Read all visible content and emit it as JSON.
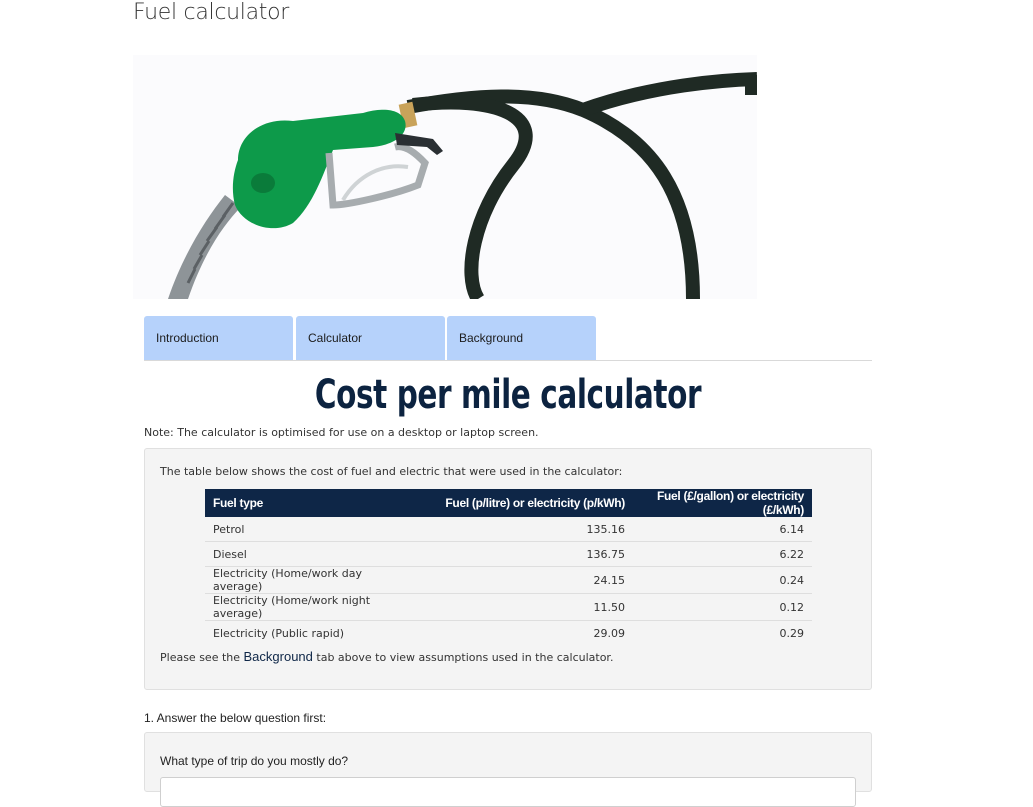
{
  "page": {
    "title": "Fuel calculator"
  },
  "hero": {
    "image": "fuel-pump-nozzle-image",
    "nozzle_color": "#0d9a4a",
    "hose_color": "#1f2a24"
  },
  "tabs": [
    {
      "label": "Introduction"
    },
    {
      "label": "Calculator"
    },
    {
      "label": "Background"
    }
  ],
  "heading": "Cost per mile calculator",
  "note": "Note: The calculator is optimised for use on a desktop or laptop screen.",
  "panel": {
    "intro": "The table below shows the cost of fuel and electric that were used in the calculator:",
    "table": {
      "headers": [
        "Fuel type",
        "Fuel (p/litre) or electricity (p/kWh)",
        "Fuel (£/gallon) or electricity (£/kWh)"
      ],
      "rows": [
        [
          "Petrol",
          "135.16",
          "6.14"
        ],
        [
          "Diesel",
          "136.75",
          "6.22"
        ],
        [
          "Electricity (Home/work day average)",
          "24.15",
          "0.24"
        ],
        [
          "Electricity (Home/work night average)",
          "11.50",
          "0.12"
        ],
        [
          "Electricity (Public rapid)",
          "29.09",
          "0.29"
        ]
      ]
    },
    "footer_before": "Please see the ",
    "footer_link": "Background",
    "footer_after": " tab above to view assumptions used in the calculator."
  },
  "step": "1. Answer the below question first:",
  "question": {
    "label": "What type of trip do you mostly do?"
  },
  "colors": {
    "tab_bg": "#b6d2fb",
    "header_bg": "#0e2647",
    "heading": "#0c2340",
    "panel_bg": "#f4f4f4"
  }
}
